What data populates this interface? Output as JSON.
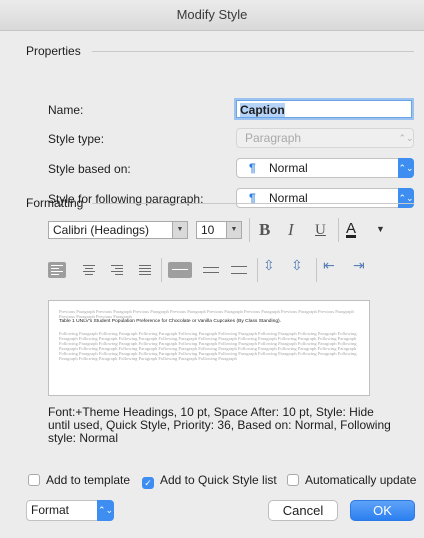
{
  "window": {
    "title": "Modify Style"
  },
  "properties": {
    "heading": "Properties",
    "name_label": "Name:",
    "name_value": "Caption",
    "style_type_label": "Style type:",
    "style_type_value": "Paragraph",
    "based_on_label": "Style based on:",
    "based_on_value": "Normal",
    "following_label": "Style for following paragraph:",
    "following_value": "Normal"
  },
  "formatting": {
    "heading": "Formatting",
    "font": "Calibri (Headings)",
    "size": "10",
    "bold": "B",
    "italic": "I",
    "underline": "U",
    "font_color": "A",
    "font_color_hex": "#000000",
    "line_spacing": {
      "single": "≡",
      "one_half": "═",
      "double": "=",
      "more_space": "⇳",
      "less_space": "⇳",
      "decrease_indent": "⇤",
      "increase_indent": "⇥"
    }
  },
  "preview": {
    "previous_text": "Previous Paragraph Previous Paragraph Previous Paragraph Previous Paragraph Previous Paragraph Previous Paragraph Previous Paragraph Previous Paragraph Previous Paragraph Previous Paragraph",
    "caption_text": "Table 1 UNLV's Student Population Preference for Chocolate or Vanilla Cupcakes (By Class Standing).",
    "following_text": "Following Paragraph Following Paragraph Following Paragraph Following Paragraph Following Paragraph Following Paragraph Following Paragraph Following Paragraph Following Paragraph Following Paragraph Following Paragraph Following Paragraph Following Paragraph Following Paragraph Following Paragraph Following Paragraph Following Paragraph Following Paragraph Following Paragraph Following Paragraph Following Paragraph Following Paragraph Following Paragraph Following Paragraph Following Paragraph Following Paragraph Following Paragraph Following Paragraph Following Paragraph Following Paragraph Following Paragraph Following Paragraph Following Paragraph Following Paragraph Following Paragraph Following Paragraph Following Paragraph Following Paragraph Following Paragraph Following Paragraph Following Paragraph Following Paragraph"
  },
  "description": "Font:+Theme Headings, 10 pt, Space After:  10 pt, Style: Hide until used, Quick Style, Priority: 36, Based on: Normal, Following style: Normal",
  "options": {
    "add_to_template": {
      "label": "Add to template",
      "checked": false
    },
    "add_to_quick_style": {
      "label": "Add to Quick Style list",
      "checked": true
    },
    "auto_update": {
      "label": "Automatically update",
      "checked": false
    }
  },
  "footer": {
    "format_label": "Format",
    "cancel_label": "Cancel",
    "ok_label": "OK"
  },
  "colors": {
    "accent": "#3d8ef0",
    "pilcrow": "#2a7de1"
  }
}
